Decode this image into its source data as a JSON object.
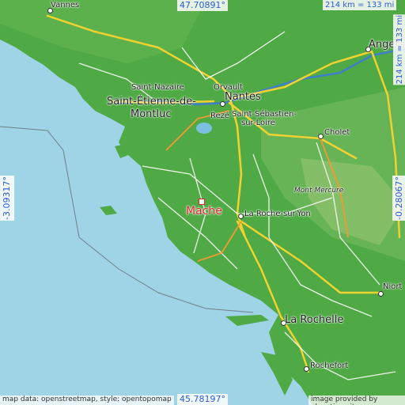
{
  "map": {
    "highlight_place": "Mache",
    "highlight_color": "#d8252b",
    "coords": {
      "top": "47.70891°",
      "bottom": "45.78197°",
      "left": "-3.09317°",
      "right": "-0.28067°"
    },
    "scale_top": "214 km = 133 mi",
    "scale_right": "214 km = 133 mi",
    "attribution_left": "map data: openstreetmap, style: opentopomap",
    "attribution_right": "image provided by elevation.city",
    "places": {
      "vannes": "Vannes",
      "angers": "Angers",
      "saint_nazaire": "Saint-Nazaire",
      "orvault": "Orvault",
      "saint_etienne_line1": "Saint-Étienne-de-",
      "saint_etienne_line2": "Montluc",
      "nantes": "Nantes",
      "reze": "Rezé",
      "saint_sebastien_line1": "Saint-Sébastien-",
      "saint_sebastien_line2": "sur-Loire",
      "cholet": "Cholet",
      "mont_mercure": "Mont Mercure",
      "la_roche": "La Roche-sur-Yon",
      "niort": "Niort",
      "la_rochelle": "La Rochelle",
      "rochefort": "Rochefort"
    },
    "colors": {
      "sea": "#9fd3e6",
      "land": "#4faa45",
      "highland": "#8cc06a",
      "road_major": "#f2d230",
      "road_minor": "#ffffff",
      "river": "#3f7fc7",
      "coord_text": "#2a5bd7"
    }
  }
}
